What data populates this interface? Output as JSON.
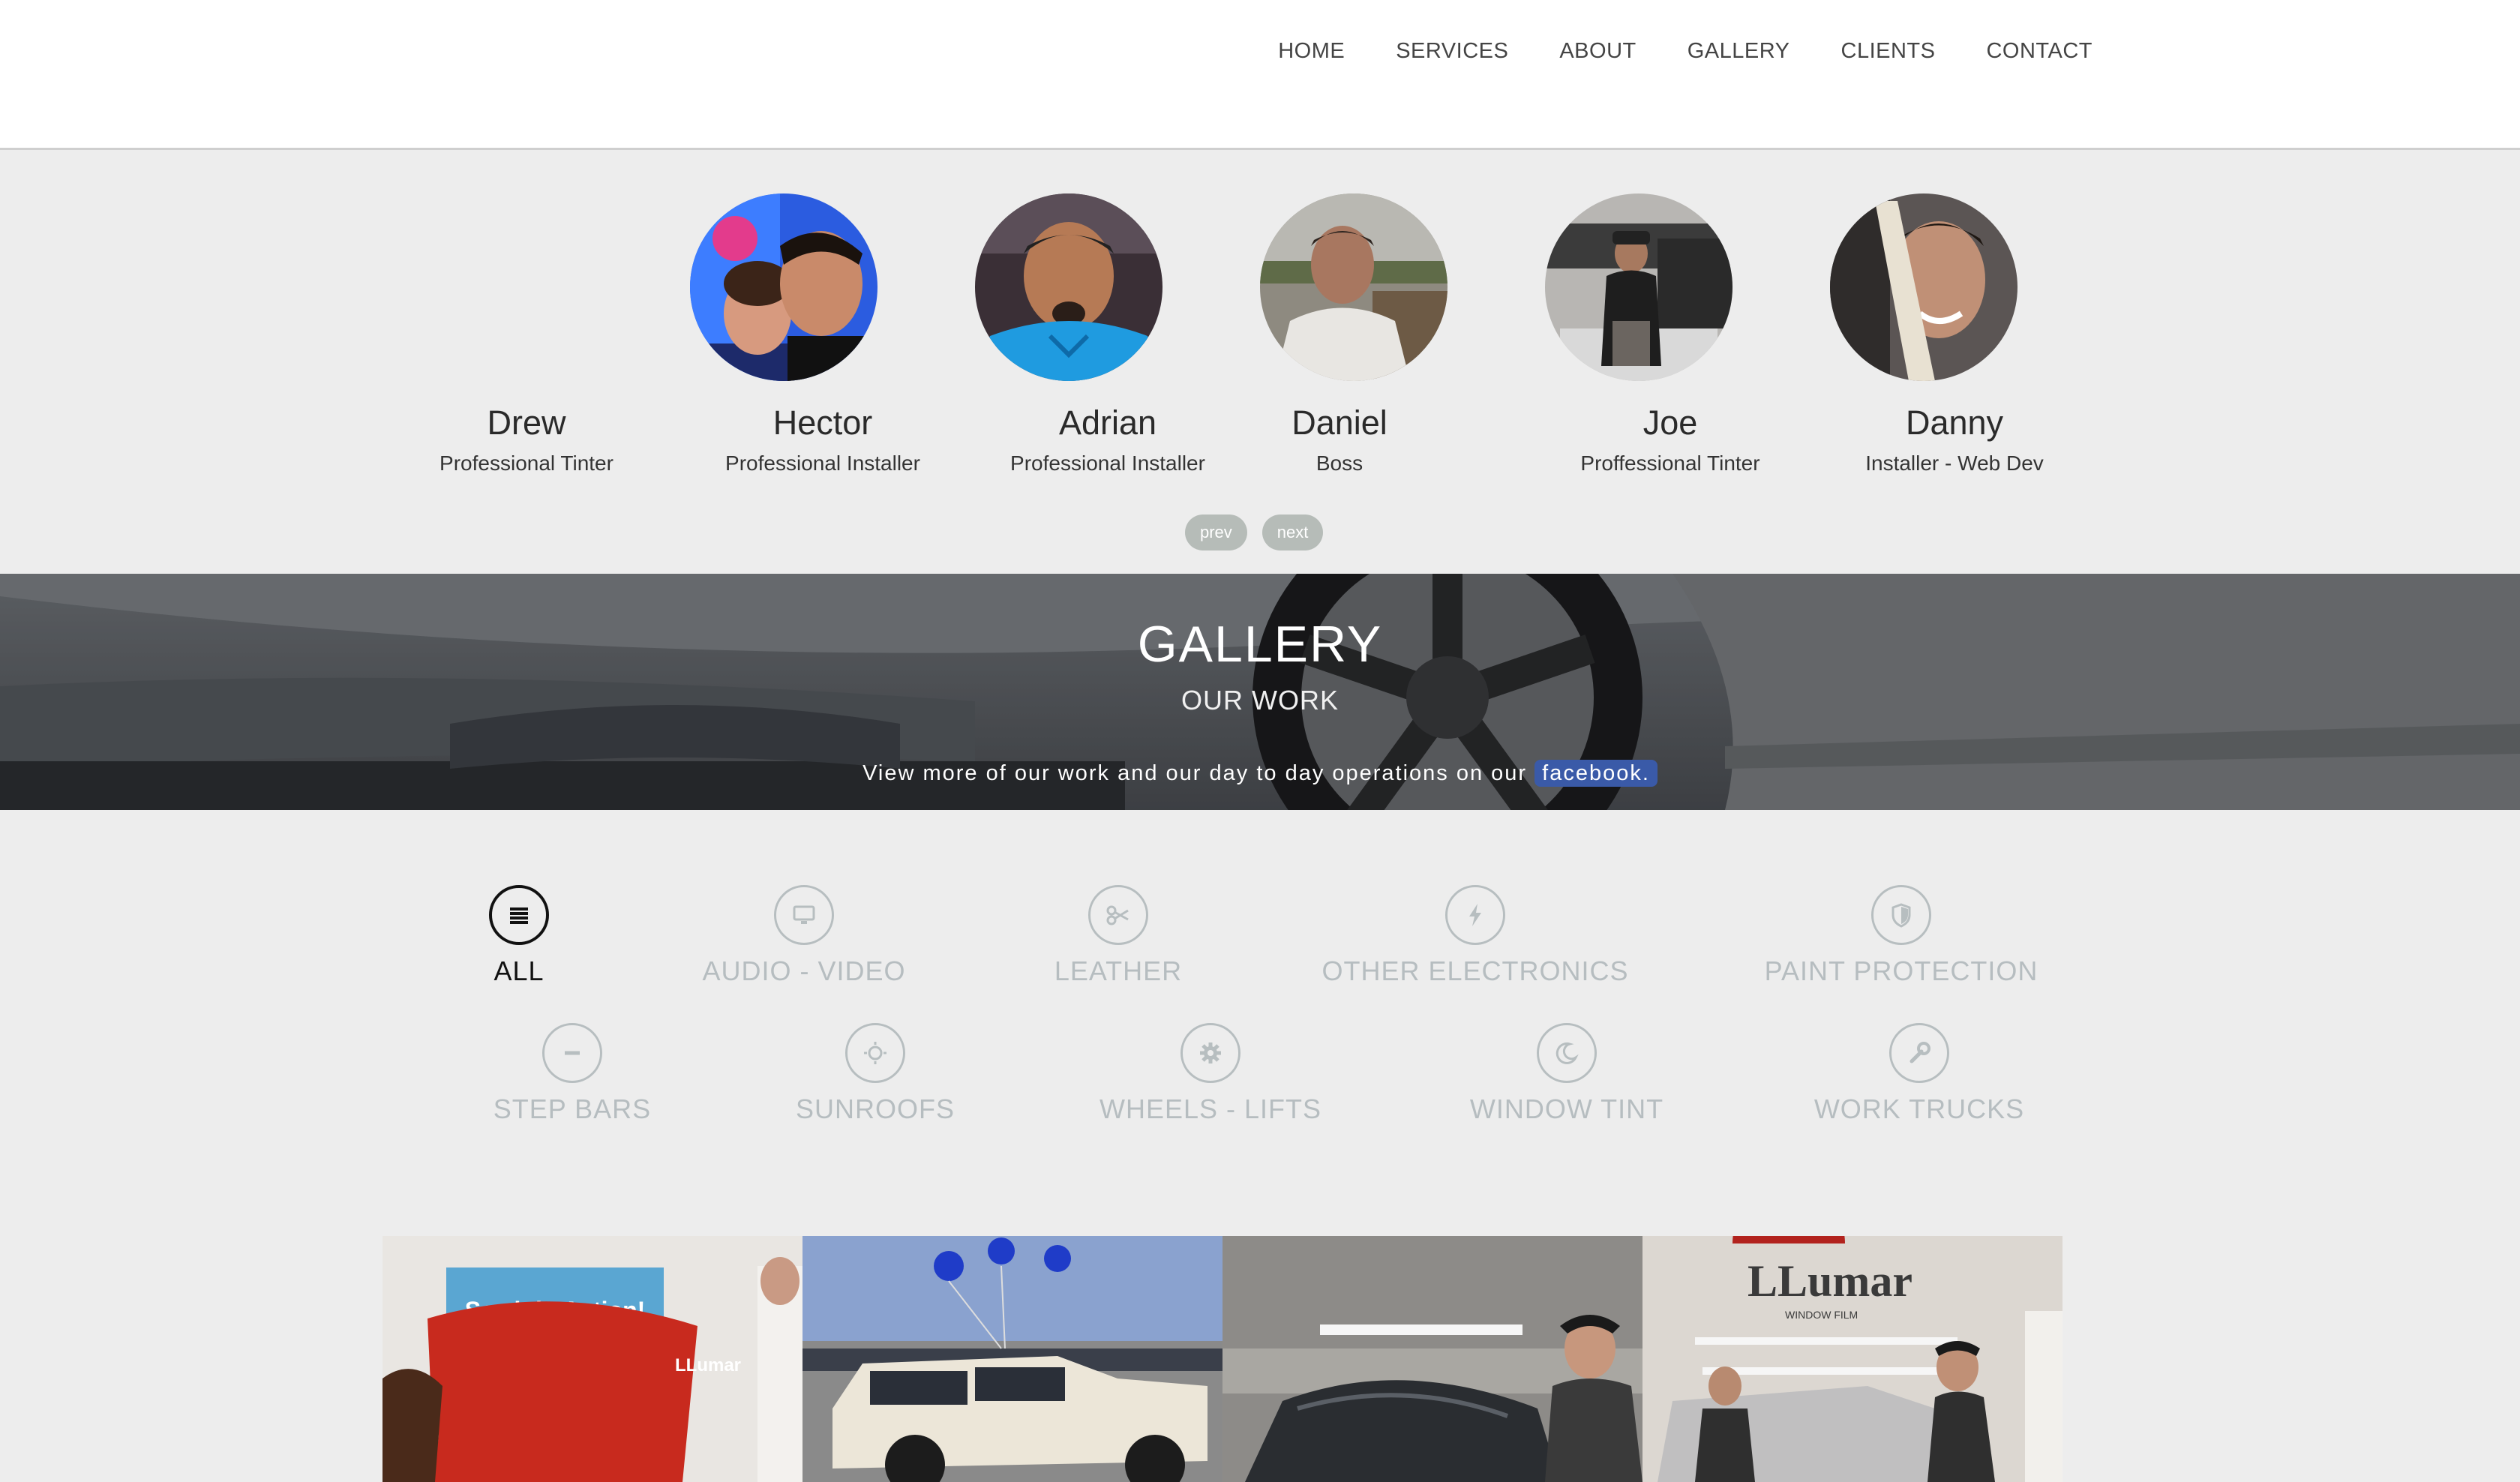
{
  "nav": [
    "HOME",
    "SERVICES",
    "ABOUT",
    "GALLERY",
    "CLIENTS",
    "CONTACT"
  ],
  "team": [
    {
      "name": "Drew",
      "role": "Professional Tinter"
    },
    {
      "name": "Hector",
      "role": "Professional Installer"
    },
    {
      "name": "Adrian",
      "role": "Professional Installer"
    },
    {
      "name": "Daniel",
      "role": "Boss"
    },
    {
      "name": "Joe",
      "role": "Proffessional Tinter"
    },
    {
      "name": "Danny",
      "role": "Installer - Web Dev"
    }
  ],
  "pager": {
    "prev": "prev",
    "next": "next"
  },
  "gallery": {
    "title": "GALLERY",
    "subtitle": "OUR WORK",
    "note": "View more of our work and our day to day operations on our",
    "link": "facebook."
  },
  "filters": [
    {
      "label": "ALL",
      "icon": "list-icon",
      "active": true
    },
    {
      "label": "AUDIO - VIDEO",
      "icon": "monitor-icon"
    },
    {
      "label": "LEATHER",
      "icon": "scissors-icon"
    },
    {
      "label": "OTHER ELECTRONICS",
      "icon": "bolt-icon"
    },
    {
      "label": "PAINT PROTECTION",
      "icon": "shield-icon"
    },
    {
      "label": "STEP BARS",
      "icon": "minus-icon"
    },
    {
      "label": "SUNROOFS",
      "icon": "sun-icon"
    },
    {
      "label": "WHEELS - LIFTS",
      "icon": "gear-icon"
    },
    {
      "label": "WINDOW TINT",
      "icon": "moon-icon"
    },
    {
      "label": "WORK TRUCKS",
      "icon": "wrench-icon"
    }
  ],
  "photos": {
    "p1_sign": "See it in Action!",
    "p1_logo": "LLumar",
    "p4_logo": "LLumar",
    "p4_tag": "WINDOW FILM"
  },
  "colors": {
    "accent": "#3a5aa8",
    "muted": "#b6bdc0",
    "background": "#ededed"
  }
}
